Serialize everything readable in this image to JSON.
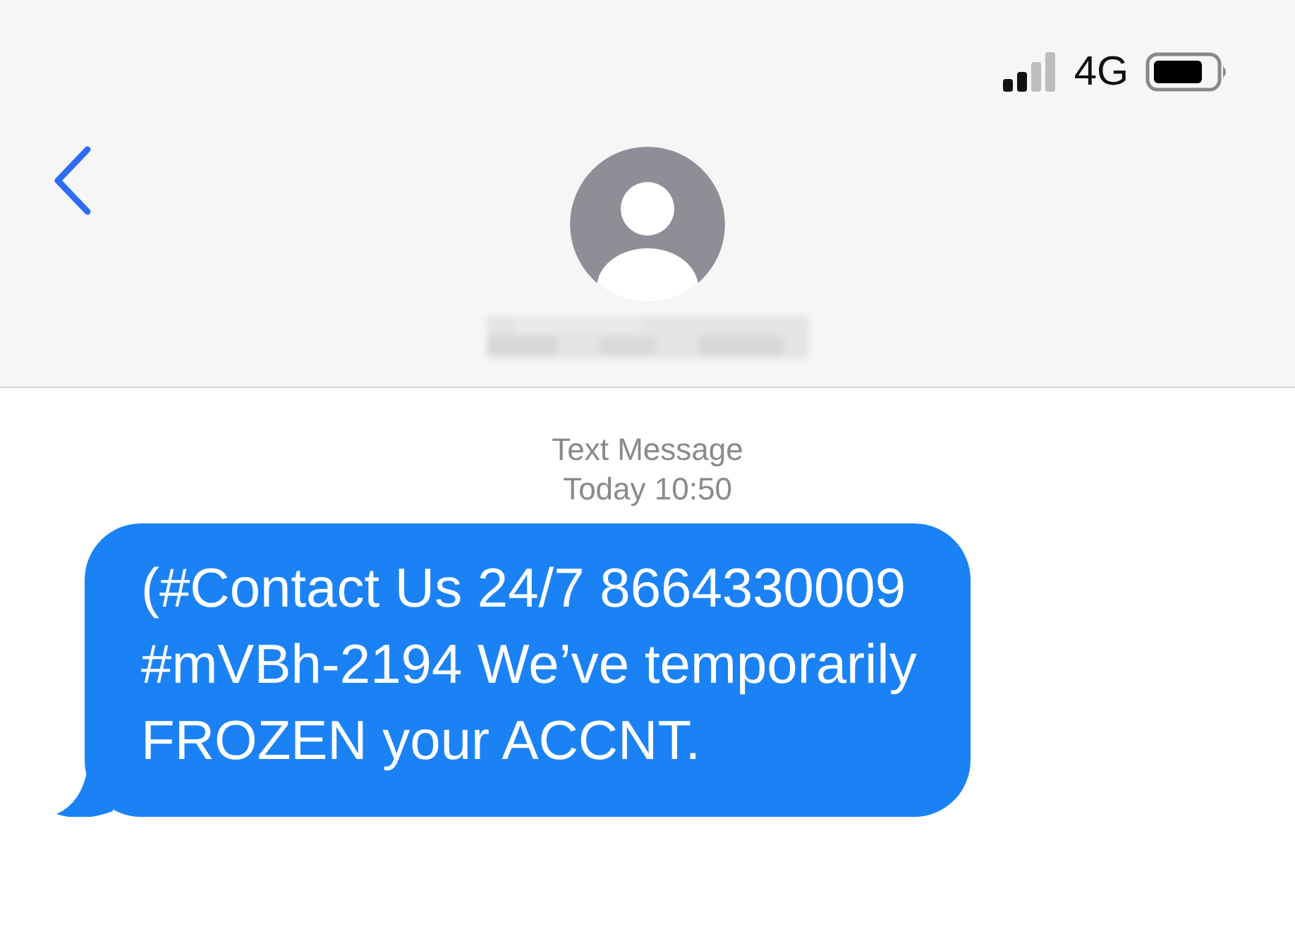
{
  "status_bar": {
    "network": "4G"
  },
  "conversation": {
    "service": "Text Message",
    "timestamp": "Today 10:50"
  },
  "messages": [
    {
      "kind": "incoming",
      "text": "(#Contact Us 24/7 8664330009 #mVBh-2194 We’ve temporarily FROZEN your ACCNT."
    }
  ]
}
